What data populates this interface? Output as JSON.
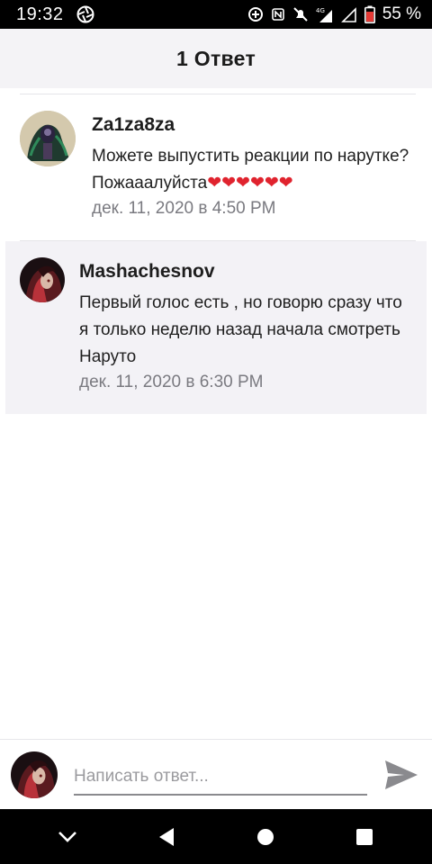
{
  "status_bar": {
    "time": "19:32",
    "battery_percent": "55 %",
    "icons": [
      "camera-aperture-icon",
      "data-saver-icon",
      "nfc-icon",
      "mute-icon",
      "signal-4g-icon",
      "signal-icon",
      "battery-icon"
    ]
  },
  "header": {
    "title": "1 Ответ"
  },
  "comments": [
    {
      "username": "Za1za8za",
      "text": "Можете выпустить реакции по нарутке? Пожааалуйста",
      "hearts": "❤❤❤❤❤❤",
      "timestamp": "дек. 11, 2020 в 4:50 PM",
      "highlighted": false
    },
    {
      "username": "Mashachesnov",
      "text": "Первый голос есть , но говорю  сразу что я только неделю назад начала смотреть Наруто",
      "timestamp": "дек. 11, 2020 в 6:30 PM",
      "highlighted": true
    }
  ],
  "reply": {
    "placeholder": "Написать ответ..."
  },
  "colors": {
    "header_bg": "#f4f3f6",
    "highlight_bg": "#f3f2f6",
    "heart": "#e0232e",
    "timestamp": "#7a7a80",
    "send_icon": "#8a8a8e"
  }
}
